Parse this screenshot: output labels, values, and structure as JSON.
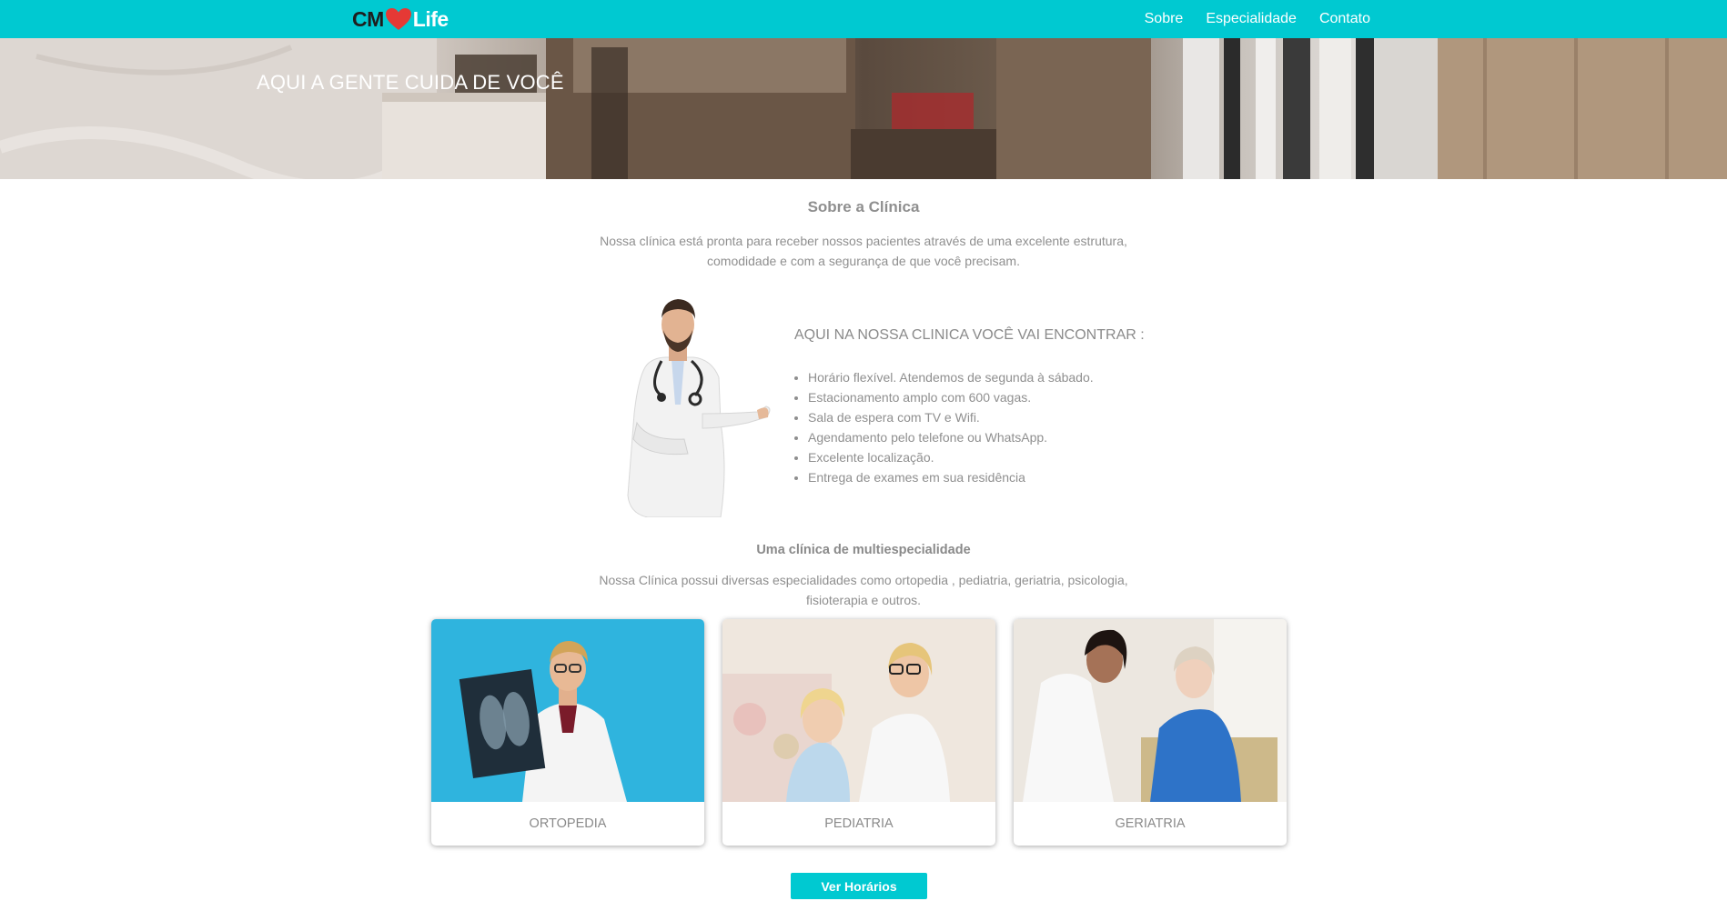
{
  "brand": {
    "cm": "CM",
    "life": "Life",
    "heart_color": "#e53935"
  },
  "nav": {
    "items": [
      "Sobre",
      "Especialidade",
      "Contato"
    ]
  },
  "hero": {
    "title": "AQUI A GENTE CUIDA DE VOCÊ"
  },
  "about": {
    "title": "Sobre a Clínica",
    "text": "Nossa clínica está pronta para receber nossos pacientes através de uma excelente estrutura, comodidade e com a segurança de que você precisam."
  },
  "features": {
    "title": "AQUI NA NOSSA CLINICA VOCÊ VAI ENCONTRAR :",
    "items": [
      "Horário flexível. Atendemos de segunda à sábado.",
      "Estacionamento amplo com 600 vagas.",
      "Sala de espera com TV e Wifi.",
      "Agendamento pelo telefone ou WhatsApp.",
      "Excelente localização.",
      "Entrega de exames em sua residência"
    ]
  },
  "multi": {
    "title": "Uma clínica de multiespecialidade",
    "text": "Nossa Clínica possui diversas especialidades como ortopedia , pediatria, geriatria, psicologia, fisioterapia e outros."
  },
  "cards": [
    {
      "label": "ORTOPEDIA"
    },
    {
      "label": "PEDIATRIA"
    },
    {
      "label": "GERIATRIA"
    }
  ],
  "cta": {
    "label": "Ver Horários"
  },
  "colors": {
    "accent": "#00c9d1",
    "text": "#8f8f8f"
  }
}
